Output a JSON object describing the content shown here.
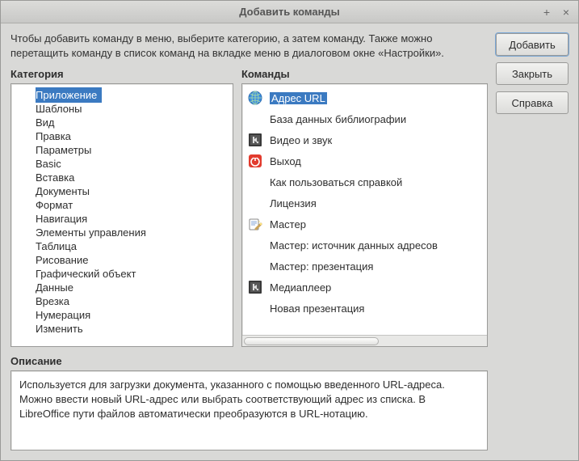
{
  "window": {
    "title": "Добавить команды"
  },
  "intro": "Чтобы добавить команду в меню, выберите категорию, а затем команду. Также можно перетащить команду в список команд на вкладке меню в диалоговом окне «Настройки».",
  "labels": {
    "category": "Категория",
    "commands": "Команды",
    "description": "Описание"
  },
  "categories": [
    "Приложение",
    "Шаблоны",
    "Вид",
    "Правка",
    "Параметры",
    "Basic",
    "Вставка",
    "Документы",
    "Формат",
    "Навигация",
    "Элементы управления",
    "Таблица",
    "Рисование",
    "Графический объект",
    "Данные",
    "Врезка",
    "Нумерация",
    "Изменить"
  ],
  "selected_category_index": 0,
  "commands": [
    {
      "icon": "globe-icon",
      "label": "Адрес URL"
    },
    {
      "icon": "",
      "label": "База данных библиографии"
    },
    {
      "icon": "media-icon",
      "label": "Видео и звук"
    },
    {
      "icon": "power-icon",
      "label": "Выход"
    },
    {
      "icon": "",
      "label": "Как пользоваться справкой"
    },
    {
      "icon": "",
      "label": "Лицензия"
    },
    {
      "icon": "wizard-icon",
      "label": "Мастер"
    },
    {
      "icon": "",
      "label": "Мастер: источник данных адресов"
    },
    {
      "icon": "",
      "label": "Мастер: презентация"
    },
    {
      "icon": "media-icon",
      "label": "Медиаплеер"
    },
    {
      "icon": "",
      "label": "Новая презентация"
    }
  ],
  "selected_command_index": 0,
  "description": "Используется для загрузки документа, указанного с помощью введенного URL-адреса. Можно ввести новый URL-адрес или выбрать соответствующий адрес из списка. В LibreOffice пути файлов автоматически преобразуются в URL-нотацию.",
  "buttons": {
    "add": "Добавить",
    "close": "Закрыть",
    "help": "Справка"
  }
}
